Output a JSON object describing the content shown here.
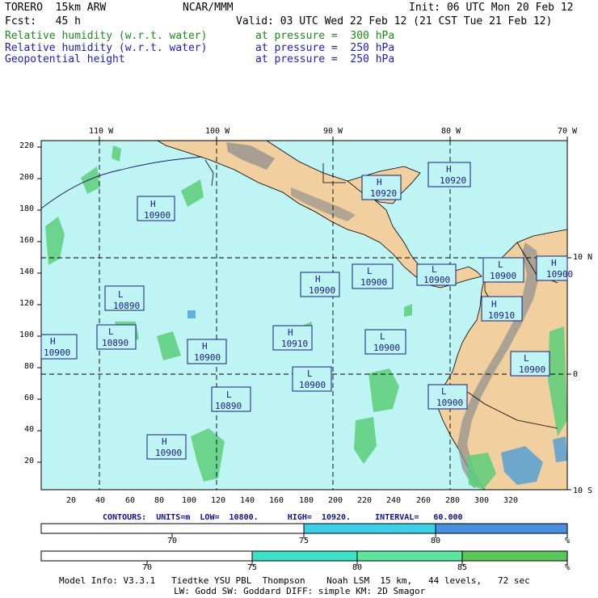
{
  "header": {
    "model": "TORERO  15km ARW",
    "center": "NCAR/MMM",
    "init": "Init: 06 UTC Mon 20 Feb 12",
    "fcst": "Fcst:   45 h",
    "valid": "Valid: 03 UTC Wed 22 Feb 12 (21 CST Tue 21 Feb 12)"
  },
  "fields": [
    {
      "name": "Relative humidity (w.r.t. water)",
      "level": "at pressure =  300 hPa",
      "color": "#1a8a1a"
    },
    {
      "name": "Relative humidity (w.r.t. water)",
      "level": "at pressure =  250 hPa",
      "color": "#1c1cc8"
    },
    {
      "name": "Geopotential height",
      "level": "at pressure =  250 hPa",
      "color": "#000000"
    }
  ],
  "map": {
    "lon_labels": [
      "110 W",
      "100 W",
      "90 W",
      "80 W",
      "70 W"
    ],
    "lat_labels_right": [
      "10 N",
      "0",
      "10 S"
    ],
    "y_ticks": [
      "220",
      "200",
      "180",
      "160",
      "140",
      "120",
      "100",
      "80",
      "60",
      "40",
      "20"
    ],
    "x_ticks": [
      "20",
      "40",
      "60",
      "80",
      "100",
      "120",
      "140",
      "160",
      "180",
      "200",
      "220",
      "240",
      "260",
      "280",
      "300",
      "320"
    ],
    "colors": {
      "ocean": "#bff4f4",
      "land": "#f2cf9e",
      "mountain": "#8f8f8f",
      "rh_green": "#5ccf7a",
      "rh_blue": "#4c9ed8"
    },
    "centers": [
      {
        "type": "H",
        "value": "10900"
      },
      {
        "type": "L",
        "value": "10890"
      },
      {
        "type": "H",
        "value": "10900"
      },
      {
        "type": "L",
        "value": "10890"
      },
      {
        "type": "H",
        "value": "10900"
      },
      {
        "type": "L",
        "value": "10890"
      },
      {
        "type": "H",
        "value": "10900"
      },
      {
        "type": "H",
        "value": "10920"
      },
      {
        "type": "H",
        "value": "10920"
      },
      {
        "type": "H",
        "value": "10900"
      },
      {
        "type": "L",
        "value": "10900"
      },
      {
        "type": "L",
        "value": "10900"
      },
      {
        "type": "H",
        "value": "10910"
      },
      {
        "type": "L",
        "value": "10900"
      },
      {
        "type": "H",
        "value": "10910"
      },
      {
        "type": "L",
        "value": "10900"
      },
      {
        "type": "L",
        "value": "10900"
      },
      {
        "type": "L",
        "value": "10900"
      },
      {
        "type": "L",
        "value": "10900"
      },
      {
        "type": "H",
        "value": "10900"
      }
    ]
  },
  "contours": {
    "title": "CONTOURS:  UNITS=m  LOW=  10800.      HIGH=  10920.     INTERVAL=   60.000"
  },
  "colorbar1": {
    "labels": [
      "70",
      "75",
      "80"
    ],
    "unit": "%",
    "colors": [
      "#ffffff",
      "#3ad0e8",
      "#4a90e0"
    ]
  },
  "colorbar2": {
    "labels": [
      "70",
      "75",
      "80",
      "85"
    ],
    "unit": "%",
    "colors": [
      "#ffffff",
      "#3ae0c8",
      "#5ae8a0",
      "#58c858"
    ]
  },
  "footer": {
    "line1": "Model Info: V3.3.1   Tiedtke YSU PBL  Thompson    Noah LSM  15 km,   44 levels,   72 sec",
    "line2": "LW: Godd SW: Goddard DIFF: simple KM: 2D Smagor"
  }
}
